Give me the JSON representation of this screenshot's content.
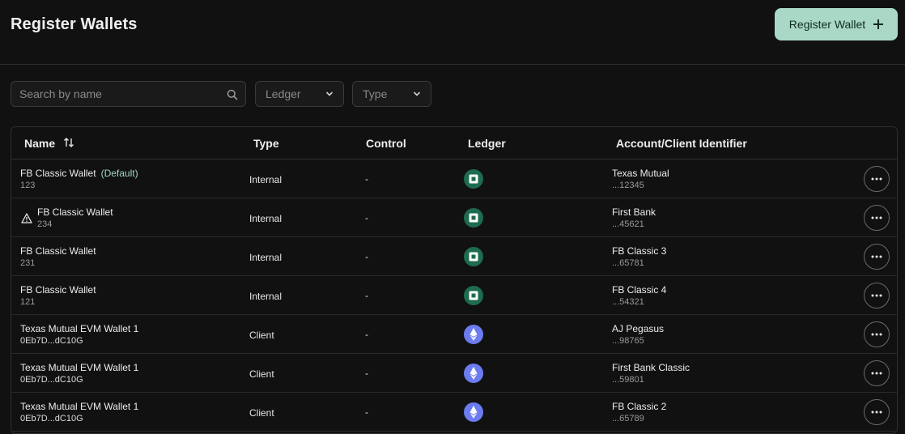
{
  "header": {
    "title": "Register Wallets",
    "register_button_label": "Register Wallet",
    "register_button_icon": "plus-icon"
  },
  "filters": {
    "search_placeholder": "Search by name",
    "search_value": "",
    "ledger_label": "Ledger",
    "type_label": "Type"
  },
  "table": {
    "columns": [
      "Name",
      "Type",
      "Control",
      "Ledger",
      "Account/Client Identifier"
    ],
    "rows": [
      {
        "name": "FB Classic Wallet",
        "tag": "(Default)",
        "sub": "123",
        "warning": false,
        "type": "Internal",
        "control": "-",
        "ledger_icon": "fb-ledger-icon",
        "account": "Texas Mutual",
        "account_id": "...12345"
      },
      {
        "name": "FB Classic Wallet",
        "tag": "",
        "sub": "234",
        "warning": true,
        "type": "Internal",
        "control": "-",
        "ledger_icon": "fb-ledger-icon",
        "account": "First Bank",
        "account_id": "...45621"
      },
      {
        "name": "FB Classic Wallet",
        "tag": "",
        "sub": "231",
        "warning": false,
        "type": "Internal",
        "control": "-",
        "ledger_icon": "fb-ledger-icon",
        "account": "FB Classic 3",
        "account_id": "...65781"
      },
      {
        "name": "FB Classic Wallet",
        "tag": "",
        "sub": "121",
        "warning": false,
        "type": "Internal",
        "control": "-",
        "ledger_icon": "fb-ledger-icon",
        "account": "FB Classic 4",
        "account_id": "...54321"
      },
      {
        "name": "Texas Mutual EVM Wallet 1",
        "tag": "",
        "sub": "0Eb7D...dC10G",
        "warning": false,
        "type": "Client",
        "control": "-",
        "ledger_icon": "ethereum-icon",
        "account": "AJ Pegasus",
        "account_id": "...98765"
      },
      {
        "name": "Texas Mutual EVM Wallet 1",
        "tag": "",
        "sub": "0Eb7D...dC10G",
        "warning": false,
        "type": "Client",
        "control": "-",
        "ledger_icon": "ethereum-icon",
        "account": "First Bank Classic",
        "account_id": "...59801"
      },
      {
        "name": "Texas Mutual EVM Wallet 1",
        "tag": "",
        "sub": "0Eb7D...dC10G",
        "warning": false,
        "type": "Client",
        "control": "-",
        "ledger_icon": "ethereum-icon",
        "account": "FB Classic 2",
        "account_id": "...65789"
      }
    ]
  },
  "colors": {
    "background": "#111111",
    "accent_button": "#a9d9c6",
    "default_tag": "#9fd8c0",
    "fb_ledger": "#1e6b4f",
    "ethereum": "#6b7cf0"
  }
}
